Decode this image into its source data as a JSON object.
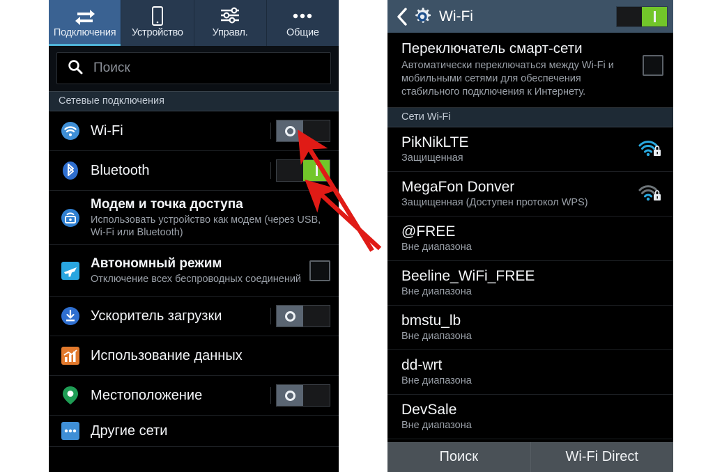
{
  "left_panel": {
    "tabs": [
      {
        "label": "Подключения",
        "icon": "connections-icon",
        "active": true
      },
      {
        "label": "Устройство",
        "icon": "device-icon",
        "active": false
      },
      {
        "label": "Управл.",
        "icon": "sliders-icon",
        "active": false
      },
      {
        "label": "Общие",
        "icon": "more-dots-icon",
        "active": false
      }
    ],
    "search": {
      "placeholder": "Поиск",
      "value": "",
      "icon": "search-icon"
    },
    "section_header": "Сетевые подключения",
    "rows": [
      {
        "title": "Wi-Fi",
        "sub": "",
        "icon": "wifi-icon",
        "control": "toggle",
        "state": "off"
      },
      {
        "title": "Bluetooth",
        "sub": "",
        "icon": "bluetooth-icon",
        "control": "toggle",
        "state": "on"
      },
      {
        "title": "Модем и точка доступа",
        "sub": "Использовать устройство как модем (через USB, Wi-Fi или Bluetooth)",
        "icon": "tethering-icon",
        "control": "none",
        "state": ""
      },
      {
        "title": "Автономный режим",
        "sub": "Отключение всех беспроводных соединений",
        "icon": "airplane-icon",
        "control": "checkbox",
        "state": "unchecked"
      },
      {
        "title": "Ускоритель загрузки",
        "sub": "",
        "icon": "download-booster-icon",
        "control": "toggle",
        "state": "off"
      },
      {
        "title": "Использование данных",
        "sub": "",
        "icon": "data-usage-icon",
        "control": "none",
        "state": ""
      },
      {
        "title": "Местоположение",
        "sub": "",
        "icon": "location-icon",
        "control": "toggle",
        "state": "off"
      },
      {
        "title": "Другие сети",
        "sub": "",
        "icon": "other-networks-icon",
        "control": "none",
        "state": ""
      }
    ]
  },
  "right_panel": {
    "header": {
      "back_icon": "back-chevron-icon",
      "gear_icon": "gear-icon",
      "title": "Wi-Fi",
      "toggle_state": "on"
    },
    "smart_switch": {
      "title": "Переключатель смарт-сети",
      "sub": "Автоматически переключаться между Wi-Fi и мобильными сетями для обеспечения стабильного подключения к Интернету.",
      "checkbox_state": "unchecked"
    },
    "section_header": "Сети Wi-Fi",
    "networks": [
      {
        "name": "PikNikLTE",
        "state": "Защищенная",
        "signal": "strong",
        "secured": true
      },
      {
        "name": "MegaFon Donver",
        "state": "Защищенная (Доступен протокол WPS)",
        "signal": "weak",
        "secured": true
      },
      {
        "name": "@FREE",
        "state": "Вне диапазона",
        "signal": "none",
        "secured": false
      },
      {
        "name": "Beeline_WiFi_FREE",
        "state": "Вне диапазона",
        "signal": "none",
        "secured": false
      },
      {
        "name": "bmstu_lb",
        "state": "Вне диапазона",
        "signal": "none",
        "secured": false
      },
      {
        "name": "dd-wrt",
        "state": "Вне диапазона",
        "signal": "none",
        "secured": false
      },
      {
        "name": "DevSale",
        "state": "Вне диапазона",
        "signal": "none",
        "secured": false
      }
    ],
    "footer": [
      {
        "label": "Поиск"
      },
      {
        "label": "Wi-Fi Direct"
      }
    ]
  },
  "annotations": {
    "arrow_color": "#e01b16",
    "arrows": [
      {
        "name": "arrow-to-wifi-toggle"
      },
      {
        "name": "arrow-to-bluetooth-toggle"
      }
    ]
  },
  "colors": {
    "accent_blue": "#3a6292",
    "toggle_on_green": "#72c62a",
    "toggle_off_grey": "#5a6572",
    "header_blue": "#3d5266",
    "section_bg": "#1e2a35"
  }
}
